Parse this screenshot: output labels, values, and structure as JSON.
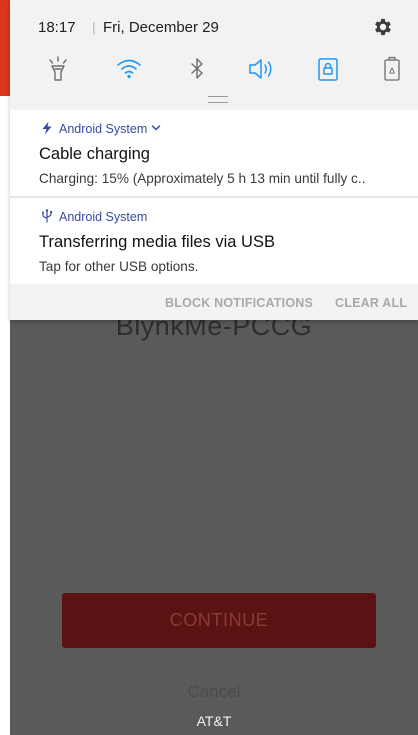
{
  "status_bar": {
    "time": "18:17",
    "separator": "|",
    "date": "Fri, December 29"
  },
  "quick_settings": [
    {
      "name": "flashlight-icon",
      "active": false
    },
    {
      "name": "wifi-icon",
      "active": true
    },
    {
      "name": "bluetooth-icon",
      "active": false
    },
    {
      "name": "sound-icon",
      "active": true
    },
    {
      "name": "rotation-lock-icon",
      "active": true
    },
    {
      "name": "power-saving-icon",
      "active": false
    }
  ],
  "colors": {
    "qs_active": "#2196f3",
    "qs_inactive": "#6e6e6e",
    "app_name": "#3a4aa0",
    "background_red": "#d8361f",
    "continue_button": "#5a1212"
  },
  "notifications": [
    {
      "app": "Android System",
      "app_icon": "bolt-icon",
      "expandable": true,
      "title": "Cable charging",
      "body": "Charging: 15% (Approximately 5 h 13 min until fully c.."
    },
    {
      "app": "Android System",
      "app_icon": "usb-icon",
      "expandable": false,
      "title": "Transferring media files via USB",
      "body": "Tap for other USB options."
    }
  ],
  "actions": {
    "block": "BLOCK NOTIFICATIONS",
    "clear": "CLEAR ALL"
  },
  "background_app": {
    "title": "BlynkMe-PCCG",
    "continue_label": "CONTINUE",
    "cancel_label": "Cancel",
    "carrier": "AT&T"
  }
}
